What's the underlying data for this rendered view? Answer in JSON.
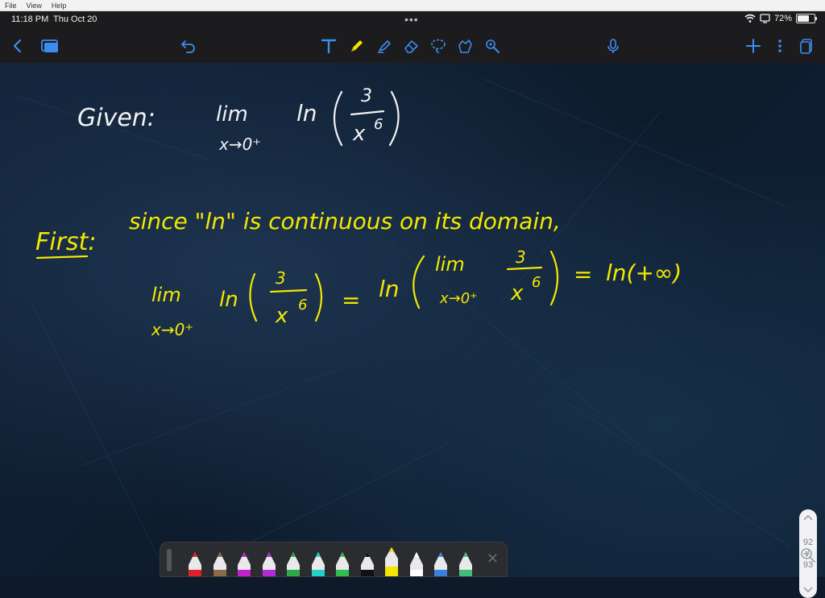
{
  "host_menu": [
    "File",
    "View",
    "Help"
  ],
  "status": {
    "time": "11:18 PM",
    "date": "Thu Oct 20",
    "battery": "72%",
    "battery_level": 0.72
  },
  "toolbar": {
    "icons": [
      "back-icon",
      "pages-icon",
      "undo-icon",
      "text-tool-icon",
      "pen-icon",
      "highlighter-icon",
      "eraser-icon",
      "lasso-icon",
      "shapes-icon",
      "laser-icon",
      "microphone-icon",
      "add-icon",
      "more-icon",
      "copy-icon"
    ]
  },
  "notes": {
    "given_label": "Given:",
    "lim": "lim",
    "limit_sub": "x→0⁺",
    "ln": "ln",
    "numerator": "3",
    "denominator": "x",
    "exponent": "6",
    "first_label": "First:",
    "sentence": "since \"ln\" is continuous on its domain,",
    "equals": "=",
    "result": "ln(+∞)"
  },
  "pager": {
    "current": "92",
    "total": "93"
  },
  "pen_tray": {
    "colors": [
      "#e0212b",
      "#8a6a4a",
      "#c21fcf",
      "#b12bd8",
      "#2ea84a",
      "#22d3c5",
      "#2fbf4e",
      "#111111",
      "#f3e600",
      "#ffffff",
      "#3b7fe0",
      "#3fbf7a"
    ],
    "accent": "#f4e800"
  }
}
